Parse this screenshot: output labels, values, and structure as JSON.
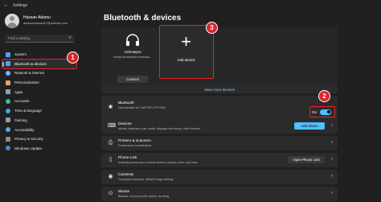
{
  "window": {
    "title": "Settings",
    "back_glyph": "←"
  },
  "user": {
    "name": "Hassan Adamu",
    "email": "adamuhassan87@outlook.com"
  },
  "search": {
    "placeholder": "Find a setting",
    "icon": "search-icon"
  },
  "sidebar": {
    "items": [
      {
        "label": "System",
        "color": "#4aa3ff"
      },
      {
        "label": "Bluetooth & devices",
        "color": "#4aa3ff",
        "active": true
      },
      {
        "label": "Network & internet",
        "color": "#6fb6ff"
      },
      {
        "label": "Personalization",
        "color": "#e3a46b"
      },
      {
        "label": "Apps",
        "color": "#8aa0b8"
      },
      {
        "label": "Accounts",
        "color": "#3fbf8f"
      },
      {
        "label": "Time & language",
        "color": "#45a8e0"
      },
      {
        "label": "Gaming",
        "color": "#9b9b9b"
      },
      {
        "label": "Accessibility",
        "color": "#5aa6e8"
      },
      {
        "label": "Privacy & security",
        "color": "#8a8a8a"
      },
      {
        "label": "Windows Update",
        "color": "#3b8fd6"
      }
    ]
  },
  "badges": {
    "one": "1",
    "two": "2",
    "three": "3"
  },
  "main": {
    "title": "Bluetooth & devices",
    "device": {
      "name": "AirDotspro",
      "status": "Setup incomplete because...",
      "connect_label": "Connect"
    },
    "add_device_tile": {
      "plus": "+",
      "label": "Add device"
    },
    "view_more_label": "View more devices",
    "rows": [
      {
        "icon": "✱",
        "title": "Bluetooth",
        "subtitle": "Discoverable as \"LAPTOP-CFTHOI6\"",
        "toggle_label": "On",
        "toggle_on": true
      },
      {
        "icon": "⌨",
        "title": "Devices",
        "subtitle": "Mouse, keyboard, pen, audio, displays and docks, other devices",
        "button_label": "Add device"
      },
      {
        "icon": "⎙",
        "title": "Printers & scanners",
        "subtitle": "Preferences, troubleshoot"
      },
      {
        "icon": "▯",
        "title": "Phone Link",
        "subtitle": "Instantly access your Android device's photos, texts, and more",
        "button_label": "Open Phone Link"
      },
      {
        "icon": "◉",
        "title": "Cameras",
        "subtitle": "Connected cameras, default image settings"
      },
      {
        "icon": "⊙",
        "title": "Mouse",
        "subtitle": "Buttons, mouse pointer speed, scrolling"
      }
    ]
  },
  "colors": {
    "highlight": "#e8242c",
    "badge": "#d9262c",
    "accent": "#4cc2ff"
  }
}
